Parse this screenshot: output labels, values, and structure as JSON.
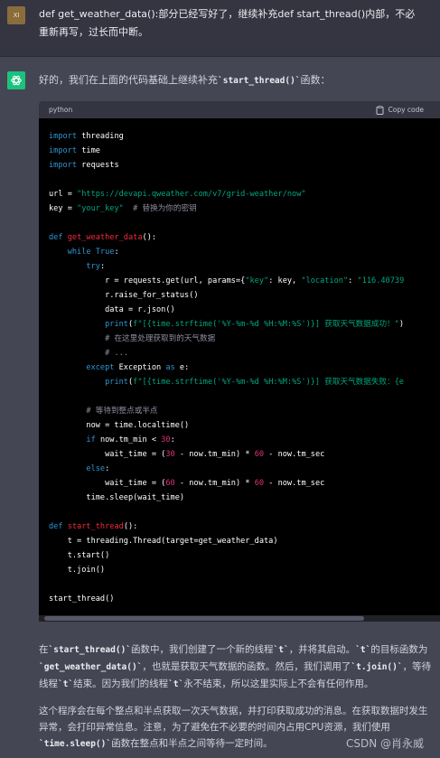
{
  "user": {
    "avatar": "XI",
    "message": "def get_weather_data():部分已经写好了，继续补充def start_thread()内部，不必重新再写，过长而中断。"
  },
  "assistant": {
    "avatar_icon": "openai-logo-icon",
    "intro_prefix": "好的，我们在上面的代码基础上继续补充",
    "intro_code": "`start_thread()`",
    "intro_suffix": "函数："
  },
  "code_block": {
    "language": "python",
    "copy_label": "Copy code"
  },
  "explanation": {
    "p1": [
      {
        "t": "在"
      },
      {
        "c": "`start_thread()`"
      },
      {
        "t": "函数中，我们创建了一个新的线程"
      },
      {
        "c": "`t`"
      },
      {
        "t": "，并将其启动。"
      },
      {
        "c": "`t`"
      },
      {
        "t": "的目标函数为"
      },
      {
        "c": "`get_weather_data()`"
      },
      {
        "t": "，也就是获取天气数据的函数。然后，我们调用了"
      },
      {
        "c": "`t.join()`"
      },
      {
        "t": "，等待线程"
      },
      {
        "c": "`t`"
      },
      {
        "t": "结束。因为我们的线程"
      },
      {
        "c": "`t`"
      },
      {
        "t": "永不结束，所以这里实际上不会有任何作用。"
      }
    ],
    "p2": [
      {
        "t": "这个程序会在每个整点和半点获取一次天气数据，并打印获取成功的消息。在获取数据时发生异常，会打印异常信息。注意，为了避免在不必要的时间内占用CPU资源，我们使用"
      },
      {
        "c": "`time.sleep()`"
      },
      {
        "t": "函数在整点和半点之间等待一定时间。"
      }
    ]
  },
  "watermark": "CSDN @肖永威",
  "colors": {
    "background": "#444654",
    "user_background": "#343541",
    "code_background": "#000000",
    "keyword": "#2e95d3",
    "function": "#f22c3d",
    "string": "#00a67d",
    "number": "#df3079",
    "comment": "#8e8ea0"
  },
  "code_lines": [
    [
      [
        "kw",
        "import"
      ],
      [
        "p",
        " threading"
      ]
    ],
    [
      [
        "kw",
        "import"
      ],
      [
        "p",
        " time"
      ]
    ],
    [
      [
        "kw",
        "import"
      ],
      [
        "p",
        " requests"
      ]
    ],
    [],
    [
      [
        "p",
        "url = "
      ],
      [
        "str",
        "\"https://devapi.qweather.com/v7/grid-weather/now\""
      ]
    ],
    [
      [
        "p",
        "key = "
      ],
      [
        "str",
        "\"your_key\""
      ],
      [
        "p",
        "  "
      ],
      [
        "cm",
        "# 替换为你的密钥"
      ]
    ],
    [],
    [
      [
        "kw",
        "def"
      ],
      [
        "p",
        " "
      ],
      [
        "fn",
        "get_weather_data"
      ],
      [
        "p",
        "():"
      ]
    ],
    [
      [
        "p",
        "    "
      ],
      [
        "kw",
        "while"
      ],
      [
        "p",
        " "
      ],
      [
        "kw",
        "True"
      ],
      [
        "p",
        ":"
      ]
    ],
    [
      [
        "p",
        "        "
      ],
      [
        "kw",
        "try"
      ],
      [
        "p",
        ":"
      ]
    ],
    [
      [
        "p",
        "            r = requests.get(url, params={"
      ],
      [
        "str",
        "\"key\""
      ],
      [
        "p",
        ": key, "
      ],
      [
        "str",
        "\"location\""
      ],
      [
        "p",
        ": "
      ],
      [
        "str",
        "\"116.40739"
      ]
    ],
    [
      [
        "p",
        "            r.raise_for_status()"
      ]
    ],
    [
      [
        "p",
        "            data = r.json()"
      ]
    ],
    [
      [
        "p",
        "            "
      ],
      [
        "kw",
        "print"
      ],
      [
        "p",
        "("
      ],
      [
        "str",
        "f\"[{time.strftime('%Y-%m-%d %H:%M:%S')}] 获取天气数据成功！\""
      ],
      [
        "p",
        ")"
      ]
    ],
    [
      [
        "p",
        "            "
      ],
      [
        "cm",
        "# 在这里处理获取到的天气数据"
      ]
    ],
    [
      [
        "p",
        "            "
      ],
      [
        "cm",
        "# ..."
      ]
    ],
    [
      [
        "p",
        "        "
      ],
      [
        "kw",
        "except"
      ],
      [
        "p",
        " Exception "
      ],
      [
        "kw",
        "as"
      ],
      [
        "p",
        " e:"
      ]
    ],
    [
      [
        "p",
        "            "
      ],
      [
        "kw",
        "print"
      ],
      [
        "p",
        "("
      ],
      [
        "str",
        "f\"[{time.strftime('%Y-%m-%d %H:%M:%S')}] 获取天气数据失败：{e"
      ]
    ],
    [],
    [
      [
        "p",
        "        "
      ],
      [
        "cm",
        "# 等待到整点或半点"
      ]
    ],
    [
      [
        "p",
        "        now = time.localtime()"
      ]
    ],
    [
      [
        "p",
        "        "
      ],
      [
        "kw",
        "if"
      ],
      [
        "p",
        " now.tm_min < "
      ],
      [
        "num",
        "30"
      ],
      [
        "p",
        ":"
      ]
    ],
    [
      [
        "p",
        "            wait_time = ("
      ],
      [
        "num",
        "30"
      ],
      [
        "p",
        " - now.tm_min) * "
      ],
      [
        "num",
        "60"
      ],
      [
        "p",
        " - now.tm_sec"
      ]
    ],
    [
      [
        "p",
        "        "
      ],
      [
        "kw",
        "else"
      ],
      [
        "p",
        ":"
      ]
    ],
    [
      [
        "p",
        "            wait_time = ("
      ],
      [
        "num",
        "60"
      ],
      [
        "p",
        " - now.tm_min) * "
      ],
      [
        "num",
        "60"
      ],
      [
        "p",
        " - now.tm_sec"
      ]
    ],
    [
      [
        "p",
        "        time.sleep(wait_time)"
      ]
    ],
    [],
    [
      [
        "kw",
        "def"
      ],
      [
        "p",
        " "
      ],
      [
        "fn",
        "start_thread"
      ],
      [
        "p",
        "():"
      ]
    ],
    [
      [
        "p",
        "    t = threading.Thread(target=get_weather_data)"
      ]
    ],
    [
      [
        "p",
        "    t.start()"
      ]
    ],
    [
      [
        "p",
        "    t.join()"
      ]
    ],
    [],
    [
      [
        "p",
        "start_thread()"
      ]
    ]
  ]
}
